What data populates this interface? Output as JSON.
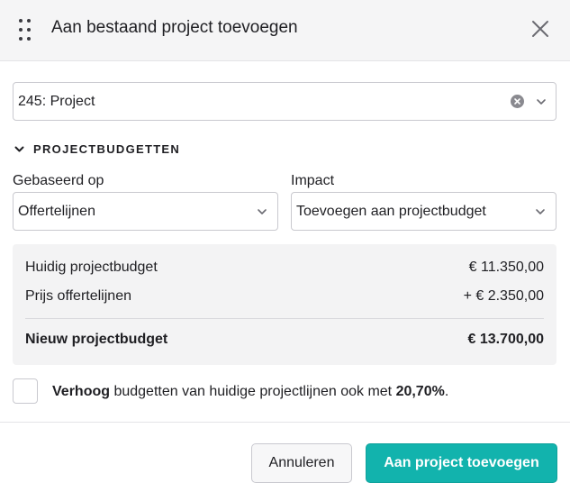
{
  "dialog": {
    "title": "Aan bestaand project toevoegen",
    "icons": {
      "drag": "drag-handle-icon",
      "close": "close-icon"
    }
  },
  "project_select": {
    "value": "245: Project"
  },
  "section": {
    "label": "PROJECTBUDGETTEN"
  },
  "based_on": {
    "label": "Gebaseerd op",
    "value": "Offertelijnen"
  },
  "impact": {
    "label": "Impact",
    "value": "Toevoegen aan projectbudget"
  },
  "summary": {
    "current_label": "Huidig projectbudget",
    "current_value": "€ 11.350,00",
    "lines_label": "Prijs offertelijnen",
    "lines_value": "+ € 2.350,00",
    "new_label": "Nieuw projectbudget",
    "new_value": "€ 13.700,00"
  },
  "increase": {
    "checked": false,
    "bold_prefix": "Verhoog",
    "text": " budgetten van huidige projectlijnen ook met ",
    "percent": "20,70%",
    "suffix": "."
  },
  "footer": {
    "cancel_label": "Annuleren",
    "confirm_label": "Aan project toevoegen"
  },
  "colors": {
    "accent": "#12b3ad",
    "header_bg": "#f5f5f6",
    "summary_bg": "#f3f3f4"
  }
}
